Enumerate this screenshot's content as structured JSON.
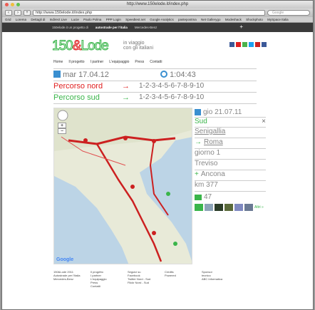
{
  "window": {
    "title": "http://www.150elode.it/index.php"
  },
  "toolbar": {
    "url": "http://www.150elode.it/index.php",
    "search_placeholder": "Google"
  },
  "bookmarks": [
    "Grid",
    "Lorema",
    "Dettagli di",
    "Indirect Live",
    "Lucie",
    "Paolo Polina",
    "PPP Login",
    "Speedtest.net",
    "Google Analytics",
    "pastepostma",
    "Net Gallerygo",
    "Modeshack",
    "Shockphoto",
    "MySpace Italia"
  ],
  "topbar": {
    "left": "150elode.it un progetto di",
    "brand1": "autostrade per l'italia",
    "brand2": "Mercedes-Benz",
    "plus": "+"
  },
  "header": {
    "logo_main": "150",
    "logo_amp": "&",
    "logo_tail": "Lode",
    "tagline_line1": "in viaggio",
    "tagline_line2": "con gli italiani"
  },
  "social_colors": [
    "#3b5998",
    "#e02020",
    "#4bb24b",
    "#1da1f2",
    "#cc2222",
    "#3b5998"
  ],
  "nav": [
    "Home",
    "Il progetto",
    "I partner",
    "L'equipaggio",
    "Press",
    "Contatti"
  ],
  "date_row": {
    "date": "mar 17.04.12",
    "time": "1:04:43"
  },
  "routes": [
    {
      "label": "Percorso nord",
      "arrow": "→",
      "sequence": "1-2-3-4-5-6-7-8-9-10",
      "color": "#e02020"
    },
    {
      "label": "Percorso sud",
      "arrow": "→",
      "sequence": "1-2-3-4-5-6-7-8-9-10",
      "color": "#3ab54a"
    }
  ],
  "sidebar": {
    "date": "gio 21.07.11",
    "direction": "Sud",
    "close": "×",
    "from_city": "Senigallia",
    "to_city": "Roma",
    "label_day": "giorno 1",
    "stop1": "Treviso",
    "stop2": "Ancona",
    "km": "km 377",
    "photos_count": "47",
    "more": "Altri »"
  },
  "map": {
    "zoom_plus": "+",
    "zoom_minus": "−",
    "google": "Google"
  },
  "footer": [
    [
      "150&Lode 2011",
      "Autostrade per l'Italia",
      "Mercedes-Benz"
    ],
    [
      "Il progetto",
      "I partner",
      "L'equipaggio",
      "Press",
      "Contatti"
    ],
    [
      "Seguici su",
      "Facebook",
      "Twitter Nord - Sud",
      "Flickr Nord - Sud"
    ],
    [
      "Credits",
      "Powered"
    ],
    [
      "Sponsor",
      "tecnico",
      "ABC Informatica"
    ]
  ]
}
